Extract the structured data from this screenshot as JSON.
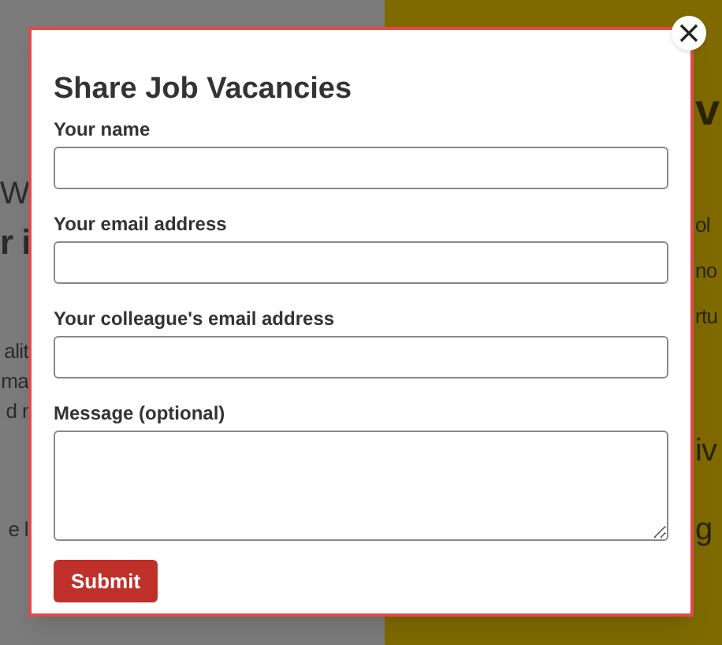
{
  "background": {
    "left_texts": [
      {
        "text": "W",
        "kind": "heading"
      },
      {
        "text": "r i",
        "kind": "bold"
      },
      {
        "text": "alit",
        "kind": "body"
      },
      {
        "text": "ma",
        "kind": "body"
      },
      {
        "text": "d r",
        "kind": "body"
      },
      {
        "text": "e l",
        "kind": "body"
      }
    ],
    "right_texts": [
      {
        "text": "v",
        "kind": "title"
      },
      {
        "text": "ol",
        "kind": "body"
      },
      {
        "text": "no",
        "kind": "body"
      },
      {
        "text": "rtu",
        "kind": "body"
      },
      {
        "text": "iv",
        "kind": "heading"
      },
      {
        "text": "g",
        "kind": "heading"
      }
    ]
  },
  "dialog": {
    "title": "Share Job Vacancies",
    "fields": [
      {
        "label": "Your name",
        "kind": "input"
      },
      {
        "label": "Your email address",
        "kind": "input"
      },
      {
        "label": "Your colleague's email address",
        "kind": "input"
      },
      {
        "label": "Message (optional)",
        "kind": "textarea"
      }
    ],
    "submit": "Submit"
  }
}
